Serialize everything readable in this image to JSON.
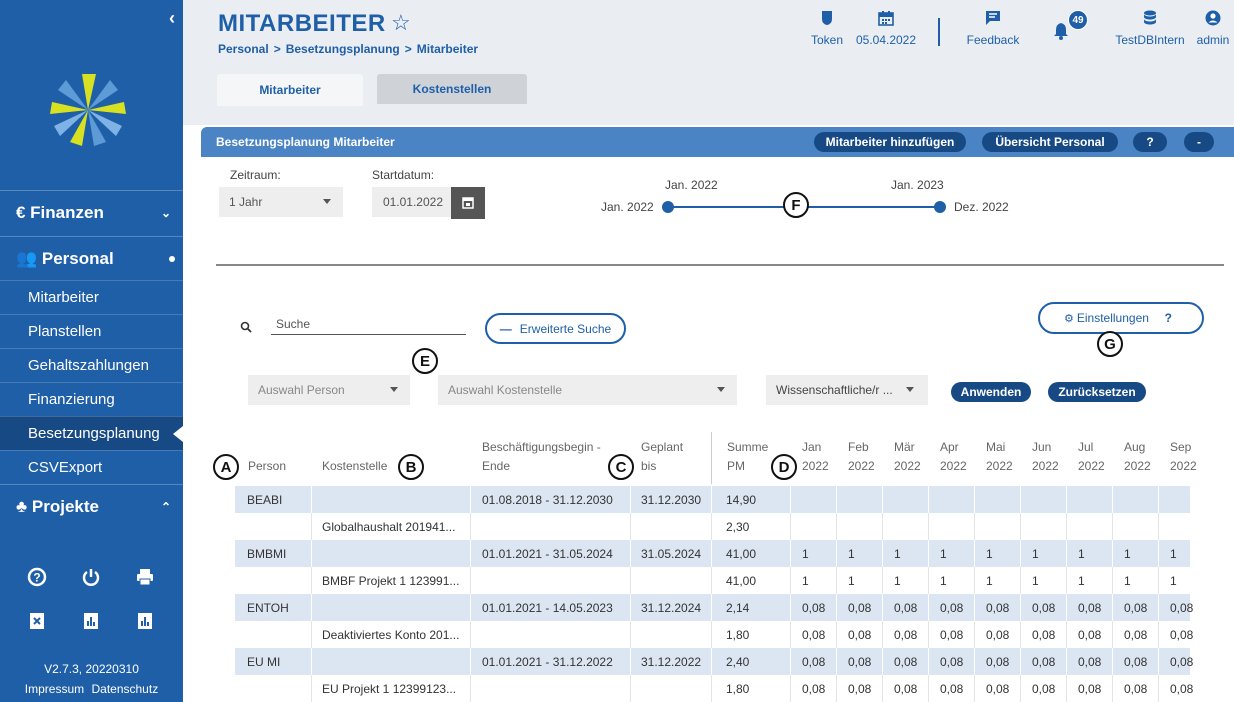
{
  "sidebar": {
    "sections": [
      {
        "label": "€ Finanzen"
      },
      {
        "label": "👥 Personal"
      },
      {
        "label": "♣ Projekte"
      }
    ],
    "items": [
      {
        "label": "Mitarbeiter"
      },
      {
        "label": "Planstellen"
      },
      {
        "label": "Gehaltszahlungen"
      },
      {
        "label": "Finanzierung"
      },
      {
        "label": "Besetzungsplanung"
      },
      {
        "label": "CSVExport"
      }
    ],
    "version": "V2.7.3, 20220310",
    "links": [
      "Impressum",
      "Datenschutz"
    ]
  },
  "header": {
    "title": "MITARBEITER",
    "breadcrumb": [
      "Personal",
      "Besetzungsplanung",
      "Mitarbeiter"
    ],
    "toolbar": {
      "token": "Token",
      "date": "05.04.2022",
      "feedback": "Feedback",
      "notification_count": "49",
      "db": "TestDBIntern",
      "user": "admin"
    },
    "tabs": [
      {
        "label": "Mitarbeiter"
      },
      {
        "label": "Kostenstellen"
      }
    ]
  },
  "panel": {
    "title": "Besetzungsplanung Mitarbeiter",
    "buttons": {
      "add": "Mitarbeiter hinzufügen",
      "overview": "Übersicht Personal",
      "help": "?",
      "collapse": "-"
    },
    "zeitraum_label": "Zeitraum:",
    "zeitraum_value": "1 Jahr",
    "startdatum_label": "Startdatum:",
    "startdatum_value": "01.01.2022",
    "slider": {
      "top_left": "Jan. 2022",
      "top_right": "Jan. 2023",
      "start": "Jan. 2022",
      "end": "Dez. 2022"
    }
  },
  "search": {
    "placeholder": "Suche",
    "advanced": "Erweiterte Suche",
    "settings": "Einstellungen",
    "settings_help": "?",
    "filter_person": "Auswahl Person",
    "filter_kostenstelle": "Auswahl Kostenstelle",
    "filter_type": "Wissenschaftliche/r ...",
    "apply": "Anwenden",
    "reset": "Zurücksetzen"
  },
  "markers": {
    "a": "A",
    "b": "B",
    "c": "C",
    "d": "D",
    "e": "E",
    "f": "F",
    "g": "G"
  },
  "table": {
    "headers": {
      "person": "Person",
      "kostenstelle": "Kostenstelle",
      "beginn_1": "Beschäftigungsbegin -",
      "beginn_2": "Ende",
      "geplant_1": "Geplant",
      "geplant_2": "bis",
      "summe_1": "Summe",
      "summe_2": "PM",
      "months": [
        [
          "Jan",
          "2022"
        ],
        [
          "Feb",
          "2022"
        ],
        [
          "Mär",
          "2022"
        ],
        [
          "Apr",
          "2022"
        ],
        [
          "Mai",
          "2022"
        ],
        [
          "Jun",
          "2022"
        ],
        [
          "Jul",
          "2022"
        ],
        [
          "Aug",
          "2022"
        ],
        [
          "Sep",
          "2022"
        ]
      ]
    },
    "rows": [
      {
        "person": "BEABI",
        "kostenstelle": "",
        "zeitraum": "01.08.2018 - 31.12.2030",
        "geplant": "31.12.2030",
        "summe": "14,90",
        "m": [
          "",
          "",
          "",
          "",
          "",
          "",
          "",
          "",
          ""
        ]
      },
      {
        "person": "",
        "kostenstelle": "Globalhaushalt 201941...",
        "zeitraum": "",
        "geplant": "",
        "summe": "2,30",
        "m": [
          "",
          "",
          "",
          "",
          "",
          "",
          "",
          "",
          ""
        ]
      },
      {
        "person": "BMBMI",
        "kostenstelle": "",
        "zeitraum": "01.01.2021 - 31.05.2024",
        "geplant": "31.05.2024",
        "summe": "41,00",
        "m": [
          "1",
          "1",
          "1",
          "1",
          "1",
          "1",
          "1",
          "1",
          "1"
        ]
      },
      {
        "person": "",
        "kostenstelle": "BMBF Projekt 1 123991...",
        "zeitraum": "",
        "geplant": "",
        "summe": "41,00",
        "m": [
          "1",
          "1",
          "1",
          "1",
          "1",
          "1",
          "1",
          "1",
          "1"
        ]
      },
      {
        "person": "ENTOH",
        "kostenstelle": "",
        "zeitraum": "01.01.2021 - 14.05.2023",
        "geplant": "31.12.2024",
        "summe": "2,14",
        "m": [
          "0,08",
          "0,08",
          "0,08",
          "0,08",
          "0,08",
          "0,08",
          "0,08",
          "0,08",
          "0,08"
        ]
      },
      {
        "person": "",
        "kostenstelle": "Deaktiviertes Konto 201...",
        "zeitraum": "",
        "geplant": "",
        "summe": "1,80",
        "m": [
          "0,08",
          "0,08",
          "0,08",
          "0,08",
          "0,08",
          "0,08",
          "0,08",
          "0,08",
          "0,08"
        ]
      },
      {
        "person": "EU MI",
        "kostenstelle": "",
        "zeitraum": "01.01.2021 - 31.12.2022",
        "geplant": "31.12.2022",
        "summe": "2,40",
        "m": [
          "0,08",
          "0,08",
          "0,08",
          "0,08",
          "0,08",
          "0,08",
          "0,08",
          "0,08",
          "0,08"
        ]
      },
      {
        "person": "",
        "kostenstelle": "EU Projekt 1 12399123...",
        "zeitraum": "",
        "geplant": "",
        "summe": "1,80",
        "m": [
          "0,08",
          "0,08",
          "0,08",
          "0,08",
          "0,08",
          "0,08",
          "0,08",
          "0,08",
          "0,08"
        ]
      }
    ]
  },
  "colors": {
    "brand": "#1f5fa8",
    "panel": "#4b84c4",
    "row_highlight": "#dce6f2"
  }
}
